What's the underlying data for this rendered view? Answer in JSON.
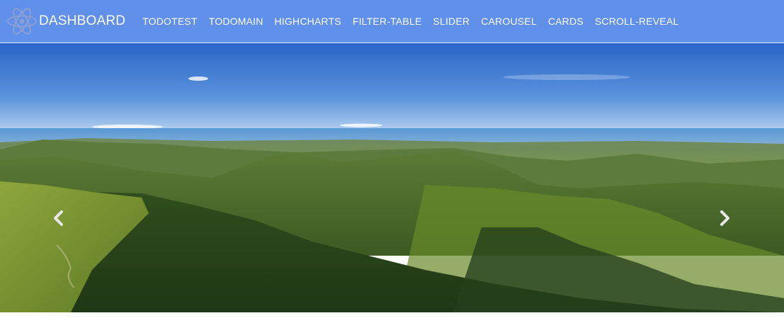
{
  "navbar": {
    "brand": {
      "label": "DASHBOARD",
      "icon": "react-atom-icon"
    },
    "links": [
      "TODOTEST",
      "TODOMAIN",
      "HIGHCHARTS",
      "FILTER-TABLE",
      "SLIDER",
      "CAROUSEL",
      "CARDS",
      "SCROLL-REVEAL"
    ]
  },
  "carousel": {
    "slide": "mountain-landscape-image",
    "prev_icon": "chevron-left-icon",
    "next_icon": "chevron-right-icon"
  },
  "colors": {
    "navbar_bg": "#6090ea",
    "text": "#ffffff",
    "sky_top": "#2a64c8",
    "sky_bottom": "#cfe3f6",
    "sea": "#5a98d6",
    "mountain_dark": "#27401c",
    "mountain_mid": "#4c6f2c",
    "grass_light": "#90a840"
  }
}
